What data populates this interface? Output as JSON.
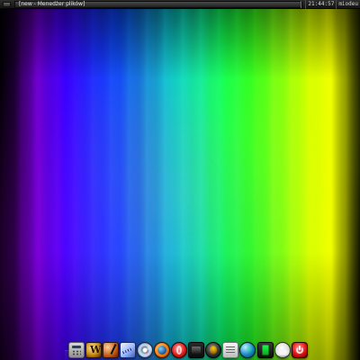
{
  "top_bar": {
    "window_title": "[new - Menedżer plików]",
    "tray_time": "21:44:57",
    "tray_user": "miodeu"
  },
  "dock": {
    "icons": [
      "calculator-icon",
      "warcraft-icon",
      "guitar-icon",
      "ruler-icon",
      "cd-icon",
      "firefox-icon",
      "opera-icon",
      "clapperboard-icon",
      "bug-icon",
      "document-icon",
      "globe-icon",
      "battery-icon",
      "cloud-icon",
      "power-icon"
    ]
  },
  "colors": {
    "top_bar_bg": "#1b1b1b",
    "accent_green": "#1eff4a",
    "power_red": "#e41414"
  }
}
